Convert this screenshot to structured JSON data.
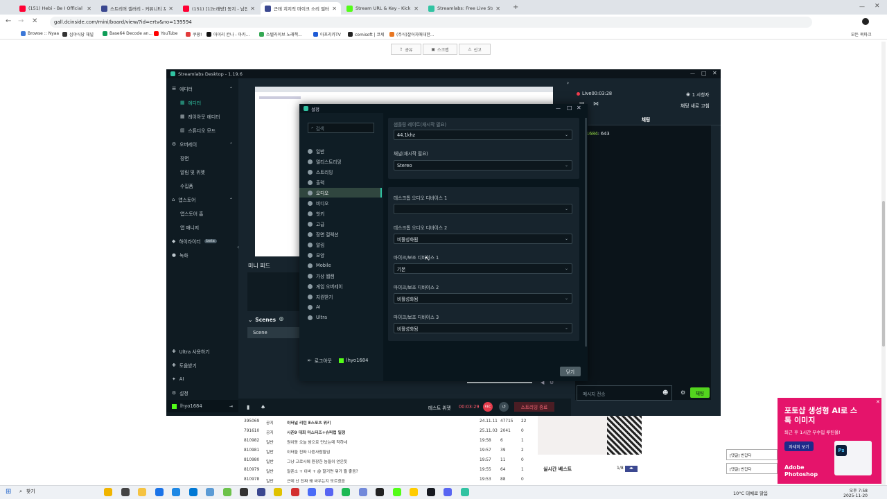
{
  "browser": {
    "tabs": [
      {
        "title": "(151) Hebi - Be I Official MV",
        "color": "#ff0033"
      },
      {
        "title": "스트리머 갤러리 - 커뮤니티 포",
        "color": "#3b4890"
      },
      {
        "title": "(151) [1]노래방] 동지 - 남진",
        "color": "#ff0033"
      },
      {
        "title": "근데 치지직 마이크 소리 필터",
        "color": "#3b4890"
      },
      {
        "title": "Stream URL & Key - Kick Dash",
        "color": "#53fc18"
      },
      {
        "title": "Streamlabs: Free Live Streamin",
        "color": "#31c3a2"
      }
    ],
    "url": "gall.dcinside.com/mini/board/view/?id=ertv&no=139594",
    "bookmarks": [
      {
        "label": "Browse :: Nyaa",
        "color": "#3c78d8"
      },
      {
        "label": "심야식당 채널",
        "color": "#333"
      },
      {
        "label": "Base64 Decode an...",
        "color": "#0f9d58"
      },
      {
        "label": "YouTube",
        "color": "#ff0000"
      },
      {
        "label": "쿠팡!",
        "color": "#e23b3b"
      },
      {
        "label": "아이리 칸나 - 아카...",
        "color": "#111"
      },
      {
        "label": "스텔라이브 노래책...",
        "color": "#34a853"
      },
      {
        "label": "아프리카TV",
        "color": "#1e5bd6"
      },
      {
        "label": "comisoft | 코세",
        "color": "#222"
      },
      {
        "label": "(주식)잘어자애대한...",
        "color": "#e87722"
      }
    ],
    "all_bookmarks": "모든 북마크"
  },
  "page": {
    "share": "공유",
    "scrap": "스크랩",
    "report": "신고"
  },
  "streamlabs": {
    "title": "Streamlabs Desktop - 1.19.6",
    "sidebar": [
      {
        "label": "에디터",
        "type": "head"
      },
      {
        "label": "에디터",
        "type": "sub-on"
      },
      {
        "label": "레이아웃 에디터",
        "type": "sub"
      },
      {
        "label": "스튜디오 모드",
        "type": "sub"
      },
      {
        "label": "오버레이",
        "type": "head"
      },
      {
        "label": "장면",
        "type": "plain"
      },
      {
        "label": "알림 및 위젯",
        "type": "plain"
      },
      {
        "label": "수집품",
        "type": "plain"
      },
      {
        "label": "앱스토어",
        "type": "head"
      },
      {
        "label": "앱스토어 홈",
        "type": "plain"
      },
      {
        "label": "앱 매니저",
        "type": "plain"
      },
      {
        "label": "하이라이터",
        "type": "beta"
      },
      {
        "label": "녹화",
        "type": "head2"
      }
    ],
    "beta": "beta",
    "sidebar_bottom": [
      "Ultra 사용하기",
      "도움받기",
      "AI",
      "설정"
    ],
    "user": "lhyo1684",
    "mini_feed": "미니 피드",
    "scenes": "Scenes",
    "scene_item": "Scene",
    "live": "Live00:03:28",
    "viewers": "1 시청자",
    "chat_refresh": "채팅 새로 고침",
    "chat_tab": "채팅",
    "chat_user": "lhyo1684",
    "chat_msg": ": 643",
    "chat_placeholder": "메시지 전송",
    "chat_send": "채팅",
    "test_widget": "테스트 위젯",
    "timer": "00:03:29",
    "rec": "REC",
    "end_stream": "스트리밍 종료"
  },
  "settings": {
    "title": "설정",
    "search_placeholder": "검색",
    "nav": [
      "일반",
      "멀티스트리밍",
      "스트리밍",
      "출력",
      "오디오",
      "비디오",
      "핫키",
      "고급",
      "장면 컬렉션",
      "알림",
      "모양",
      "Mobile",
      "가상 웹캠",
      "게임 오버레이",
      "지원받기",
      "AI",
      "Ultra"
    ],
    "active_nav": "오디오",
    "logout": "로그아웃",
    "user": "lhyo1684",
    "sample_rate_label": "샘플링 레이트(재시작 필요)",
    "sample_rate": "44.1khz",
    "channel_label": "채널(재시작 필요)",
    "channel": "Stereo",
    "desktop1_label": "데스크톱 오디오 디바이스 1",
    "desktop1": "",
    "desktop2_label": "데스크톱 오디오 디바이스 2",
    "desktop2": "비활성화됨",
    "mic1_label": "마이크/보조 디바이스 1",
    "mic1": "기본",
    "mic2_label": "마이크/보조 디바이스 2",
    "mic2": "비활성화됨",
    "mic3_label": "마이크/보조 디바이스 3",
    "mic3": "비활성화됨",
    "close": "닫기"
  },
  "board_rows": [
    {
      "no": "395069",
      "cat": "공지",
      "title": "이터널 리턴 E스포츠 위키",
      "date": "24.11.11",
      "views": "47715",
      "rec": "22"
    },
    {
      "no": "791610",
      "cat": "공지",
      "title": "시즌9 대회 마스터즈+슈퍼컵 일정",
      "date": "25.11.03",
      "views": "2041",
      "rec": "0"
    },
    {
      "no": "810982",
      "cat": "일반",
      "title": "원이랑 오늘 밤으로 만났는데 착하네",
      "date": "19:58",
      "views": "6",
      "rec": "1"
    },
    {
      "no": "810981",
      "cat": "일반",
      "title": "이터들 진짜 나쁜사람들임",
      "date": "19:57",
      "views": "39",
      "rec": "2"
    },
    {
      "no": "810980",
      "cat": "일반",
      "title": "그냥 고로시에 환장한 놈들이 얻은듯",
      "date": "19:57",
      "views": "11",
      "rec": "0"
    },
    {
      "no": "810979",
      "cat": "일반",
      "title": "알폰소 + 이바 + @ 할거면 뭐가 뭘 좋음?",
      "date": "19:55",
      "views": "64",
      "rec": "1"
    },
    {
      "no": "810978",
      "cat": "일반",
      "title": "근데 난 진짜 왜 싸우는지 모르겠음",
      "date": "19:53",
      "views": "88",
      "rec": "0"
    }
  ],
  "realtime_best": "실시간 베스트",
  "realtime_page": "1/8",
  "comment1": "[댓글] 반갑다",
  "comment2": "[댓글] 반갑다",
  "ad": {
    "title": "포토샵 생성형 AI로 스톡 이미지",
    "sub": "퇴근 후 1시간 부수입 루틴올!",
    "cta": "자세히 보기",
    "brand": "Adobe Photoshop"
  },
  "taskbar": {
    "search": "찾기",
    "weather": "10°C 대체로 맑음",
    "time": "오후 7:58",
    "date": "2025-11-20"
  }
}
